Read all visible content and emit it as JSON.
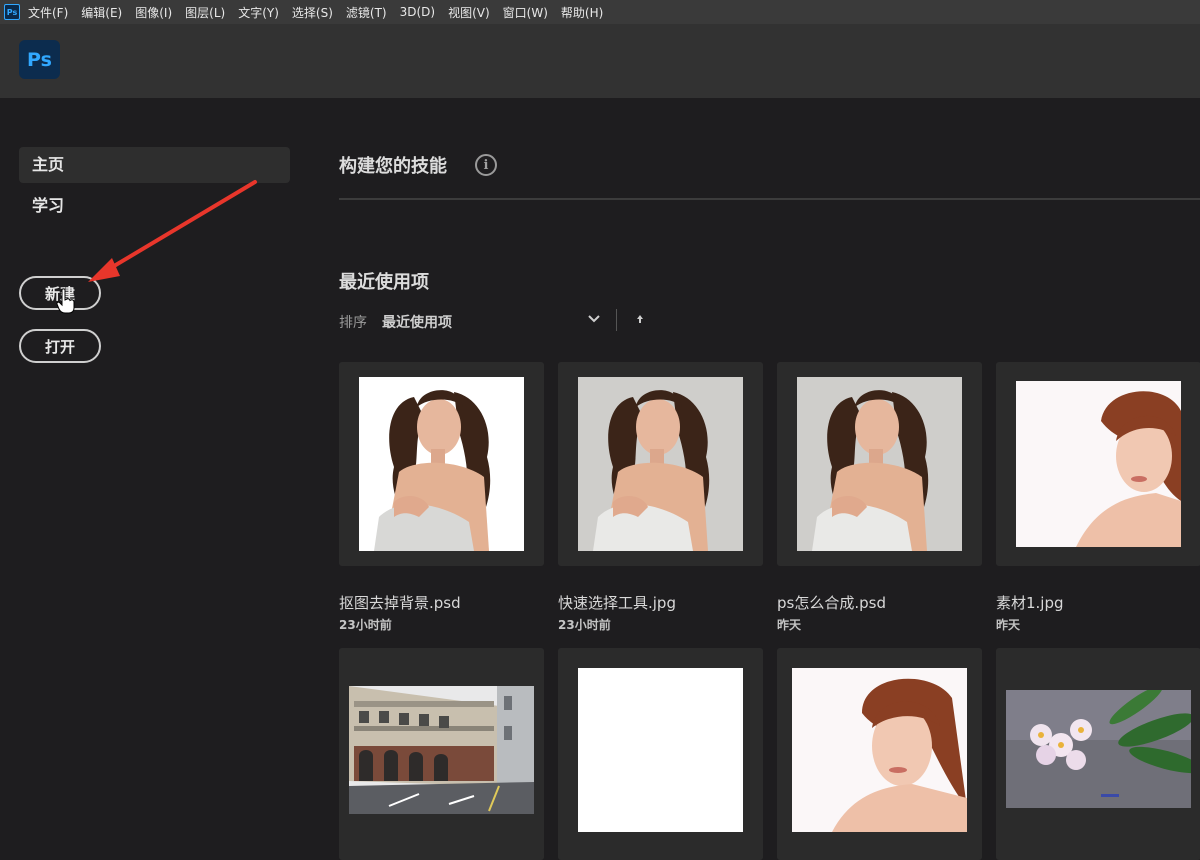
{
  "menubar": {
    "app_icon_label": "Ps",
    "items": [
      "文件(F)",
      "编辑(E)",
      "图像(I)",
      "图层(L)",
      "文字(Y)",
      "选择(S)",
      "滤镜(T)",
      "3D(D)",
      "视图(V)",
      "窗口(W)",
      "帮助(H)"
    ]
  },
  "header": {
    "logo_label": "Ps"
  },
  "sidebar": {
    "home_label": "主页",
    "learn_label": "学习",
    "new_label": "新建",
    "open_label": "打开"
  },
  "content": {
    "skills_title": "构建您的技能",
    "info_icon_glyph": "i",
    "recent_title": "最近使用项",
    "sort_label": "排序",
    "sort_value": "最近使用项"
  },
  "recent_files": [
    {
      "name": "抠图去掉背景.psd",
      "time": "23小时前",
      "thumb": "woman-white-bg"
    },
    {
      "name": "快速选择工具.jpg",
      "time": "23小时前",
      "thumb": "woman-grey-bg"
    },
    {
      "name": "ps怎么合成.psd",
      "time": "昨天",
      "thumb": "woman-grey-bg"
    },
    {
      "name": "素材1.jpg",
      "time": "昨天",
      "thumb": "redhead-portrait"
    },
    {
      "name": "",
      "time": "",
      "thumb": "street-scene"
    },
    {
      "name": "",
      "time": "",
      "thumb": "blank-white"
    },
    {
      "name": "",
      "time": "",
      "thumb": "redhead-portrait"
    },
    {
      "name": "",
      "time": "",
      "thumb": "flowers"
    }
  ],
  "colors": {
    "accent": "#31a8ff",
    "annotation_arrow": "#e8362b"
  }
}
